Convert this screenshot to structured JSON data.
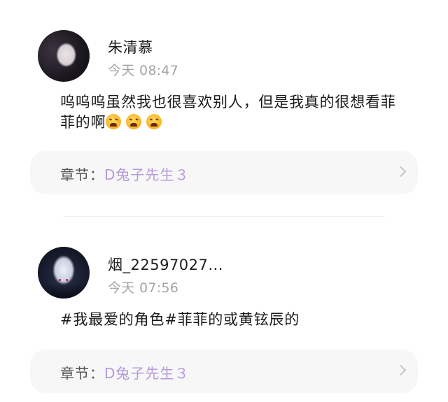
{
  "comments": [
    {
      "user": "朱清慕",
      "time": "今天 08:47",
      "text_line1": "呜呜呜虽然我也很喜欢别人，但是我真的很想看菲",
      "text_line2": "菲的啊",
      "emoji_count": 3,
      "chapter_label": "章节：",
      "chapter_name": "D兔子先生３"
    },
    {
      "user": "烟_22597027...",
      "time": "今天 07:56",
      "text_line1": "#我最爱的角色#菲菲的或黄铉辰的",
      "chapter_label": "章节：",
      "chapter_name": "D兔子先生３"
    }
  ]
}
